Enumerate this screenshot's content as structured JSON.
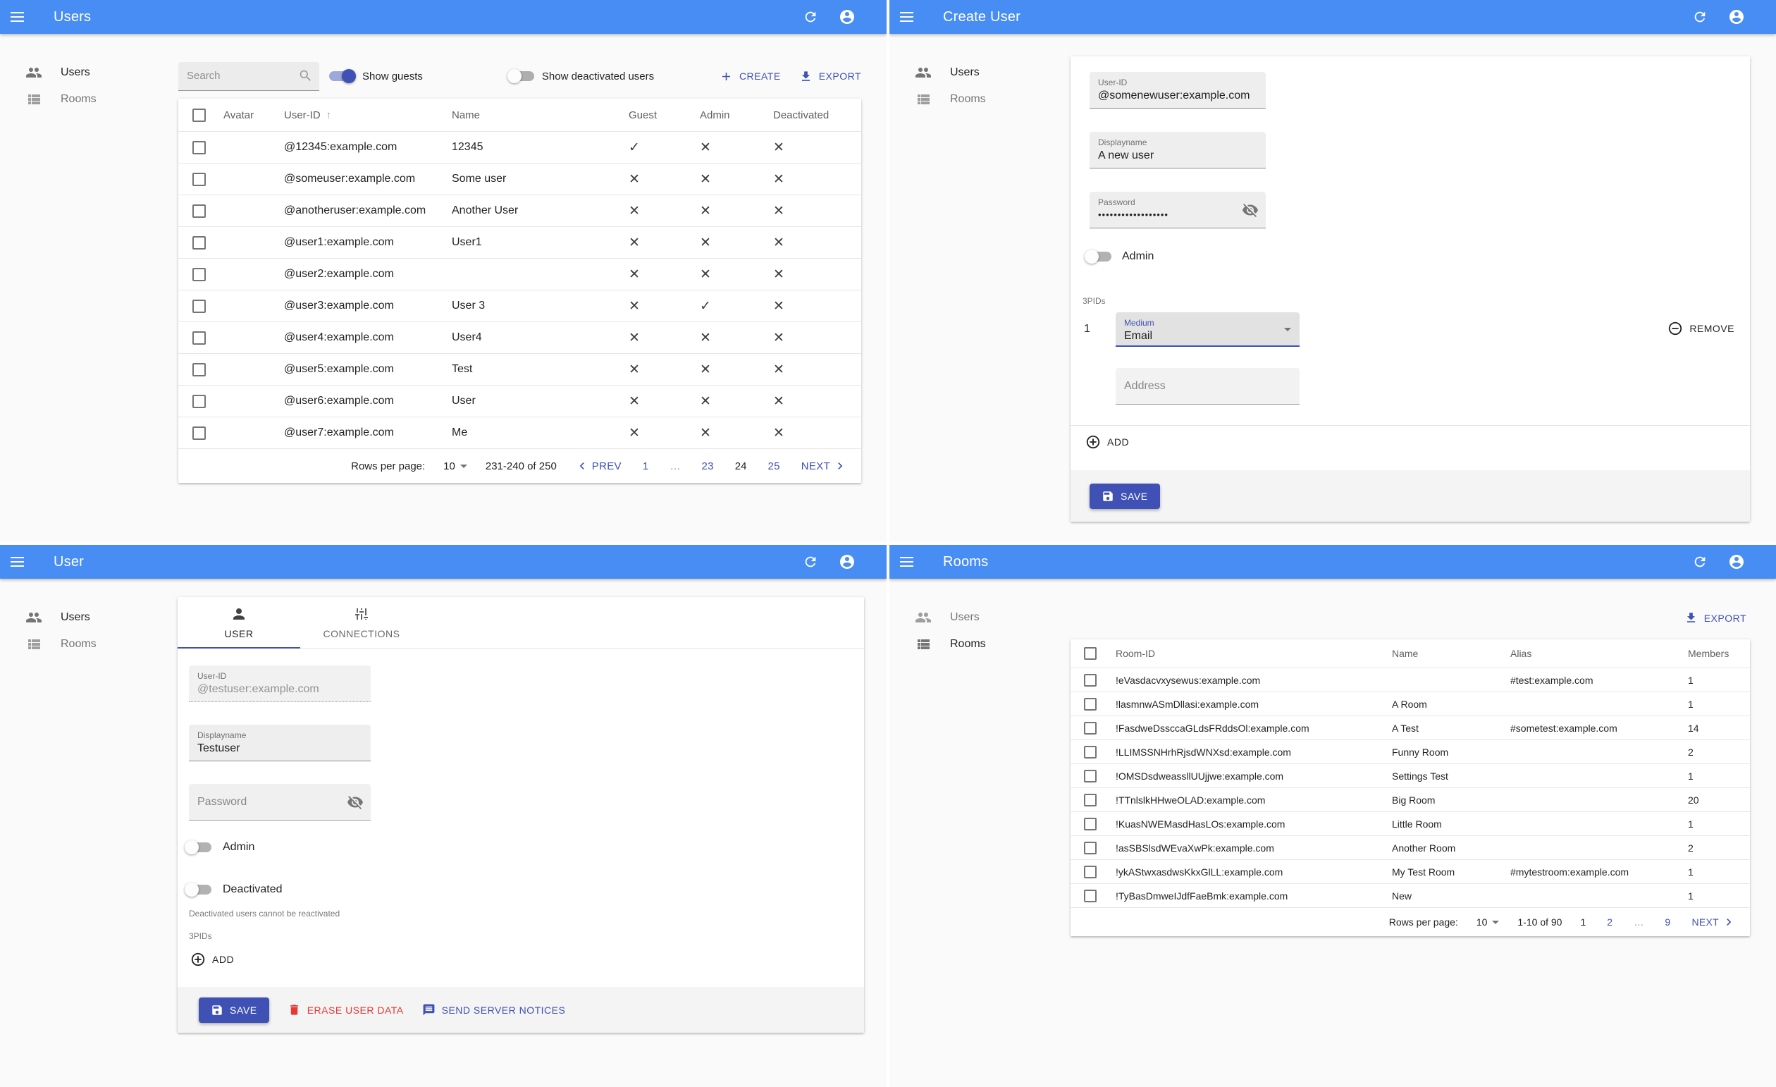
{
  "colors": {
    "appbar": "#478df4",
    "accent": "#3f51b5",
    "danger": "#e53935"
  },
  "icons": {
    "check": "✓",
    "cross": "✕",
    "sort_asc": "↑",
    "ellipsis": "…"
  },
  "sidebar": {
    "users": "Users",
    "rooms": "Rooms"
  },
  "users_list": {
    "title": "Users",
    "search_placeholder": "Search",
    "show_guests": "Show guests",
    "show_deactivated": "Show deactivated users",
    "create": "CREATE",
    "export": "EXPORT",
    "headers": {
      "avatar": "Avatar",
      "user_id": "User-ID",
      "name": "Name",
      "guest": "Guest",
      "admin": "Admin",
      "deactivated": "Deactivated"
    },
    "rows": [
      {
        "user_id": "@12345:example.com",
        "name": "12345",
        "guest": true,
        "admin": false,
        "deactivated": false
      },
      {
        "user_id": "@someuser:example.com",
        "name": "Some user",
        "guest": false,
        "admin": false,
        "deactivated": false
      },
      {
        "user_id": "@anotheruser:example.com",
        "name": "Another User",
        "guest": false,
        "admin": false,
        "deactivated": false
      },
      {
        "user_id": "@user1:example.com",
        "name": "User1",
        "guest": false,
        "admin": false,
        "deactivated": false
      },
      {
        "user_id": "@user2:example.com",
        "name": "",
        "guest": false,
        "admin": false,
        "deactivated": false
      },
      {
        "user_id": "@user3:example.com",
        "name": "User 3",
        "guest": false,
        "admin": true,
        "deactivated": false
      },
      {
        "user_id": "@user4:example.com",
        "name": "User4",
        "guest": false,
        "admin": false,
        "deactivated": false
      },
      {
        "user_id": "@user5:example.com",
        "name": "Test",
        "guest": false,
        "admin": false,
        "deactivated": false
      },
      {
        "user_id": "@user6:example.com",
        "name": "User",
        "guest": false,
        "admin": false,
        "deactivated": false
      },
      {
        "user_id": "@user7:example.com",
        "name": "Me",
        "guest": false,
        "admin": false,
        "deactivated": false
      }
    ],
    "pagination": {
      "rows_per_page_label": "Rows per page:",
      "rows_per_page": "10",
      "range": "231-240 of 250",
      "prev": "PREV",
      "next": "NEXT",
      "pages": [
        {
          "label": "1",
          "type": "link"
        },
        {
          "label": "…",
          "type": "ellipsis"
        },
        {
          "label": "23",
          "type": "link"
        },
        {
          "label": "24",
          "type": "current"
        },
        {
          "label": "25",
          "type": "link"
        }
      ]
    }
  },
  "create_user": {
    "title": "Create User",
    "user_id": {
      "label": "User-ID",
      "value": "@somenewuser:example.com"
    },
    "displayname": {
      "label": "Displayname",
      "value": "A new user"
    },
    "password": {
      "label": "Password",
      "value": "••••••••••••••••••"
    },
    "admin_label": "Admin",
    "threepids_label": "3PIDs",
    "threepid": {
      "index": "1",
      "medium_label": "Medium",
      "medium_value": "Email",
      "remove": "REMOVE",
      "address_placeholder": "Address"
    },
    "add": "ADD",
    "save": "SAVE"
  },
  "user_detail": {
    "title": "User",
    "tab_user": "USER",
    "tab_connections": "CONNECTIONS",
    "user_id": {
      "label": "User-ID",
      "value": "@testuser:example.com"
    },
    "displayname": {
      "label": "Displayname",
      "value": "Testuser"
    },
    "password_placeholder": "Password",
    "admin_label": "Admin",
    "deactivated_label": "Deactivated",
    "deactivated_hint": "Deactivated users cannot be reactivated",
    "threepids_label": "3PIDs",
    "add": "ADD",
    "save": "SAVE",
    "erase": "ERASE USER DATA",
    "notices": "SEND SERVER NOTICES"
  },
  "rooms": {
    "title": "Rooms",
    "export": "EXPORT",
    "headers": {
      "room_id": "Room-ID",
      "name": "Name",
      "alias": "Alias",
      "members": "Members"
    },
    "rows": [
      {
        "room_id": "!eVasdacvxysewus:example.com",
        "name": "",
        "alias": "#test:example.com",
        "members": "1"
      },
      {
        "room_id": "!lasmnwASmDllasi:example.com",
        "name": "A Room",
        "alias": "",
        "members": "1"
      },
      {
        "room_id": "!FasdweDssccaGLdsFRddsOl:example.com",
        "name": "A Test",
        "alias": "#sometest:example.com",
        "members": "14"
      },
      {
        "room_id": "!LLIMSSNHrhRjsdWNXsd:example.com",
        "name": "Funny Room",
        "alias": "",
        "members": "2"
      },
      {
        "room_id": "!OMSDsdweassllUUjjwe:example.com",
        "name": "Settings Test",
        "alias": "",
        "members": "1"
      },
      {
        "room_id": "!TTnlslkHHweOLAD:example.com",
        "name": "Big Room",
        "alias": "",
        "members": "20"
      },
      {
        "room_id": "!KuasNWEMasdHasLOs:example.com",
        "name": "Little Room",
        "alias": "",
        "members": "1"
      },
      {
        "room_id": "!asSBSlsdWEvaXwPk:example.com",
        "name": "Another Room",
        "alias": "",
        "members": "2"
      },
      {
        "room_id": "!ykAStwxasdwsKkxGlLL:example.com",
        "name": "My Test Room",
        "alias": "#mytestroom:example.com",
        "members": "1"
      },
      {
        "room_id": "!TyBasDmweIJdfFaeBmk:example.com",
        "name": "New",
        "alias": "",
        "members": "1"
      }
    ],
    "pagination": {
      "rows_per_page_label": "Rows per page:",
      "rows_per_page": "10",
      "range": "1-10 of 90",
      "next": "NEXT",
      "pages": [
        {
          "label": "1",
          "type": "current"
        },
        {
          "label": "2",
          "type": "link"
        },
        {
          "label": "…",
          "type": "ellipsis"
        },
        {
          "label": "9",
          "type": "link"
        }
      ]
    }
  }
}
